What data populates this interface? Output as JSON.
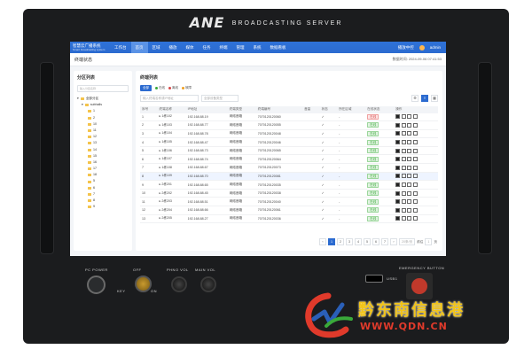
{
  "device": {
    "brand_logo": "ANE",
    "brand_tagline": "BROADCASTING SERVER",
    "pc_power_label": "PC POWER",
    "key_off_label": "OFF",
    "key_label": "KEY",
    "key_on_label": "ON",
    "phn_vol_label": "PHNO VOL",
    "main_vol_label": "MAIN VOL",
    "usb_label": "USB1",
    "emergency_label": "EMERGENCY BUTTON",
    "colors": {
      "body": "#1b1c1e",
      "emergency": "#c0392b",
      "key": "#c89a2f"
    }
  },
  "app": {
    "title_line1": "智慧云广播系统",
    "title_line2": "Smart broadcasting system",
    "nav_items": [
      "工作台",
      "首页",
      "区域",
      "播放",
      "媒体",
      "任务",
      "终端",
      "管理",
      "系统",
      "数据看板"
    ],
    "active_nav": 1,
    "user_name": "admin",
    "nav_right_text": "播放中控",
    "accent": "#2c6bd0"
  },
  "page": {
    "title": "终端状态",
    "timestamp": "数据时间: 2024-09-06 07:41:53"
  },
  "tree": {
    "title": "分区列表",
    "search_placeholder": "输入分区名称",
    "root": "全部分区",
    "group": "subhalls",
    "nodes": [
      "1",
      "2",
      "10",
      "11",
      "12",
      "13",
      "14",
      "15",
      "16",
      "17",
      "18",
      "5",
      "6",
      "7",
      "8",
      "9"
    ]
  },
  "terminal": {
    "title": "终端列表",
    "all_button": "全部",
    "legend": [
      {
        "label": "在线",
        "color": "#3aa93a"
      },
      {
        "label": "离线",
        "color": "#d64545"
      },
      {
        "label": "故障",
        "color": "#f0a020"
      }
    ],
    "filter_placeholder": "输入终端名称或IP地址",
    "filter_select": "全部设备类型",
    "columns": [
      "序号",
      "终端名称",
      "IP地址",
      "终端类型",
      "终端编号",
      "音量",
      "状态",
      "所在区域",
      "在线状态",
      "操作"
    ],
    "rows": [
      {
        "no": "1",
        "name": "1栋102",
        "ip": "192.168.88.19",
        "type": "网络音箱",
        "code": "7070120120060",
        "vol": "",
        "status": "✓",
        "area": "-",
        "online": "在线",
        "highlight": false,
        "offline": true
      },
      {
        "no": "2",
        "name": "1栋103",
        "ip": "192.168.88.77",
        "type": "网络音箱",
        "code": "7070120120055",
        "vol": "",
        "status": "✓",
        "area": "-",
        "online": "在线",
        "highlight": false,
        "offline": false
      },
      {
        "no": "3",
        "name": "1栋104",
        "ip": "192.168.88.78",
        "type": "网络音箱",
        "code": "7070120120048",
        "vol": "",
        "status": "✓",
        "area": "-",
        "online": "在线",
        "highlight": false,
        "offline": false
      },
      {
        "no": "4",
        "name": "1栋105",
        "ip": "192.168.88.47",
        "type": "网络音箱",
        "code": "7070120120046",
        "vol": "",
        "status": "✓",
        "area": "-",
        "online": "在线",
        "highlight": false,
        "offline": false
      },
      {
        "no": "5",
        "name": "1栋106",
        "ip": "192.168.88.73",
        "type": "网络音箱",
        "code": "7070120120065",
        "vol": "",
        "status": "✓",
        "area": "-",
        "online": "在线",
        "highlight": false,
        "offline": false
      },
      {
        "no": "6",
        "name": "1栋107",
        "ip": "192.168.88.74",
        "type": "网络音箱",
        "code": "7070120120064",
        "vol": "",
        "status": "✓",
        "area": "-",
        "online": "在线",
        "highlight": false,
        "offline": false
      },
      {
        "no": "7",
        "name": "1栋108",
        "ip": "192.168.88.67",
        "type": "网络音箱",
        "code": "7070120120073",
        "vol": "",
        "status": "✓",
        "area": "-",
        "online": "在线",
        "highlight": false,
        "offline": false
      },
      {
        "no": "8",
        "name": "1栋109",
        "ip": "192.168.88.70",
        "type": "网络音箱",
        "code": "7070120120081",
        "vol": "",
        "status": "✓",
        "area": "-",
        "online": "在线",
        "highlight": true,
        "offline": false
      },
      {
        "no": "9",
        "name": "2栋201",
        "ip": "192.168.88.65",
        "type": "网络音箱",
        "code": "7070120120035",
        "vol": "",
        "status": "✓",
        "area": "-",
        "online": "在线",
        "highlight": false,
        "offline": false
      },
      {
        "no": "10",
        "name": "2栋202",
        "ip": "192.168.88.45",
        "type": "网络音箱",
        "code": "7070120120038",
        "vol": "",
        "status": "✓",
        "area": "-",
        "online": "在线",
        "highlight": false,
        "offline": false
      },
      {
        "no": "11",
        "name": "2栋203",
        "ip": "192.168.88.51",
        "type": "网络音箱",
        "code": "7070120120040",
        "vol": "",
        "status": "✓",
        "area": "-",
        "online": "在线",
        "highlight": false,
        "offline": false
      },
      {
        "no": "12",
        "name": "2栋204",
        "ip": "192.168.88.66",
        "type": "网络音箱",
        "code": "7070120120061",
        "vol": "",
        "status": "✓",
        "area": "-",
        "online": "在线",
        "highlight": false,
        "offline": false
      },
      {
        "no": "13",
        "name": "2栋205",
        "ip": "192.168.88.27",
        "type": "网络音箱",
        "code": "7070120120036",
        "vol": "",
        "status": "✓",
        "area": "-",
        "online": "在线",
        "highlight": false,
        "offline": false
      }
    ],
    "pages": [
      "1",
      "2",
      "3",
      "4",
      "5",
      "6",
      "7"
    ],
    "active_page": 0,
    "page_size": "20条/页",
    "goto_label": "前往",
    "goto_value": "1",
    "goto_suffix": "页"
  },
  "watermark": {
    "text": "黔东南信息港",
    "url": "WWW.QDN.CN"
  }
}
